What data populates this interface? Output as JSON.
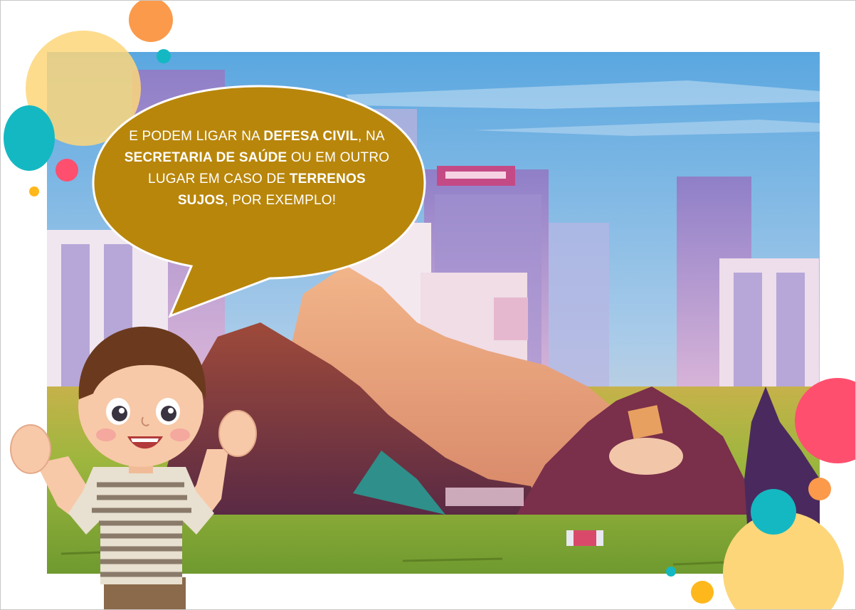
{
  "speech_bubble": {
    "segments": [
      {
        "text": "E PODEM LIGAR NA ",
        "bold": false
      },
      {
        "text": "DEFESA CIVIL",
        "bold": true
      },
      {
        "text": ", NA ",
        "bold": false
      },
      {
        "text": "SECRETARIA DE SAÚDE",
        "bold": true
      },
      {
        "text": " OU EM OUTRO LUGAR EM CASO DE ",
        "bold": false
      },
      {
        "text": "TERRENOS SUJOS",
        "bold": true
      },
      {
        "text": ", POR EXEMPLO!",
        "bold": false
      }
    ],
    "fill_color": "#b8860b"
  },
  "colors": {
    "sky_top": "#5aa7e0",
    "sky_bottom": "#d8c4e8",
    "grass": "#8fae3a",
    "dot_orange": "#fb9a4b",
    "dot_teal": "#14b8c2",
    "dot_yellow": "#fdd67a",
    "dot_pink": "#ff4f6e",
    "dot_gold": "#ffb81c"
  },
  "illustration": {
    "scene": "city-dump-scene",
    "character": "boy-character"
  }
}
